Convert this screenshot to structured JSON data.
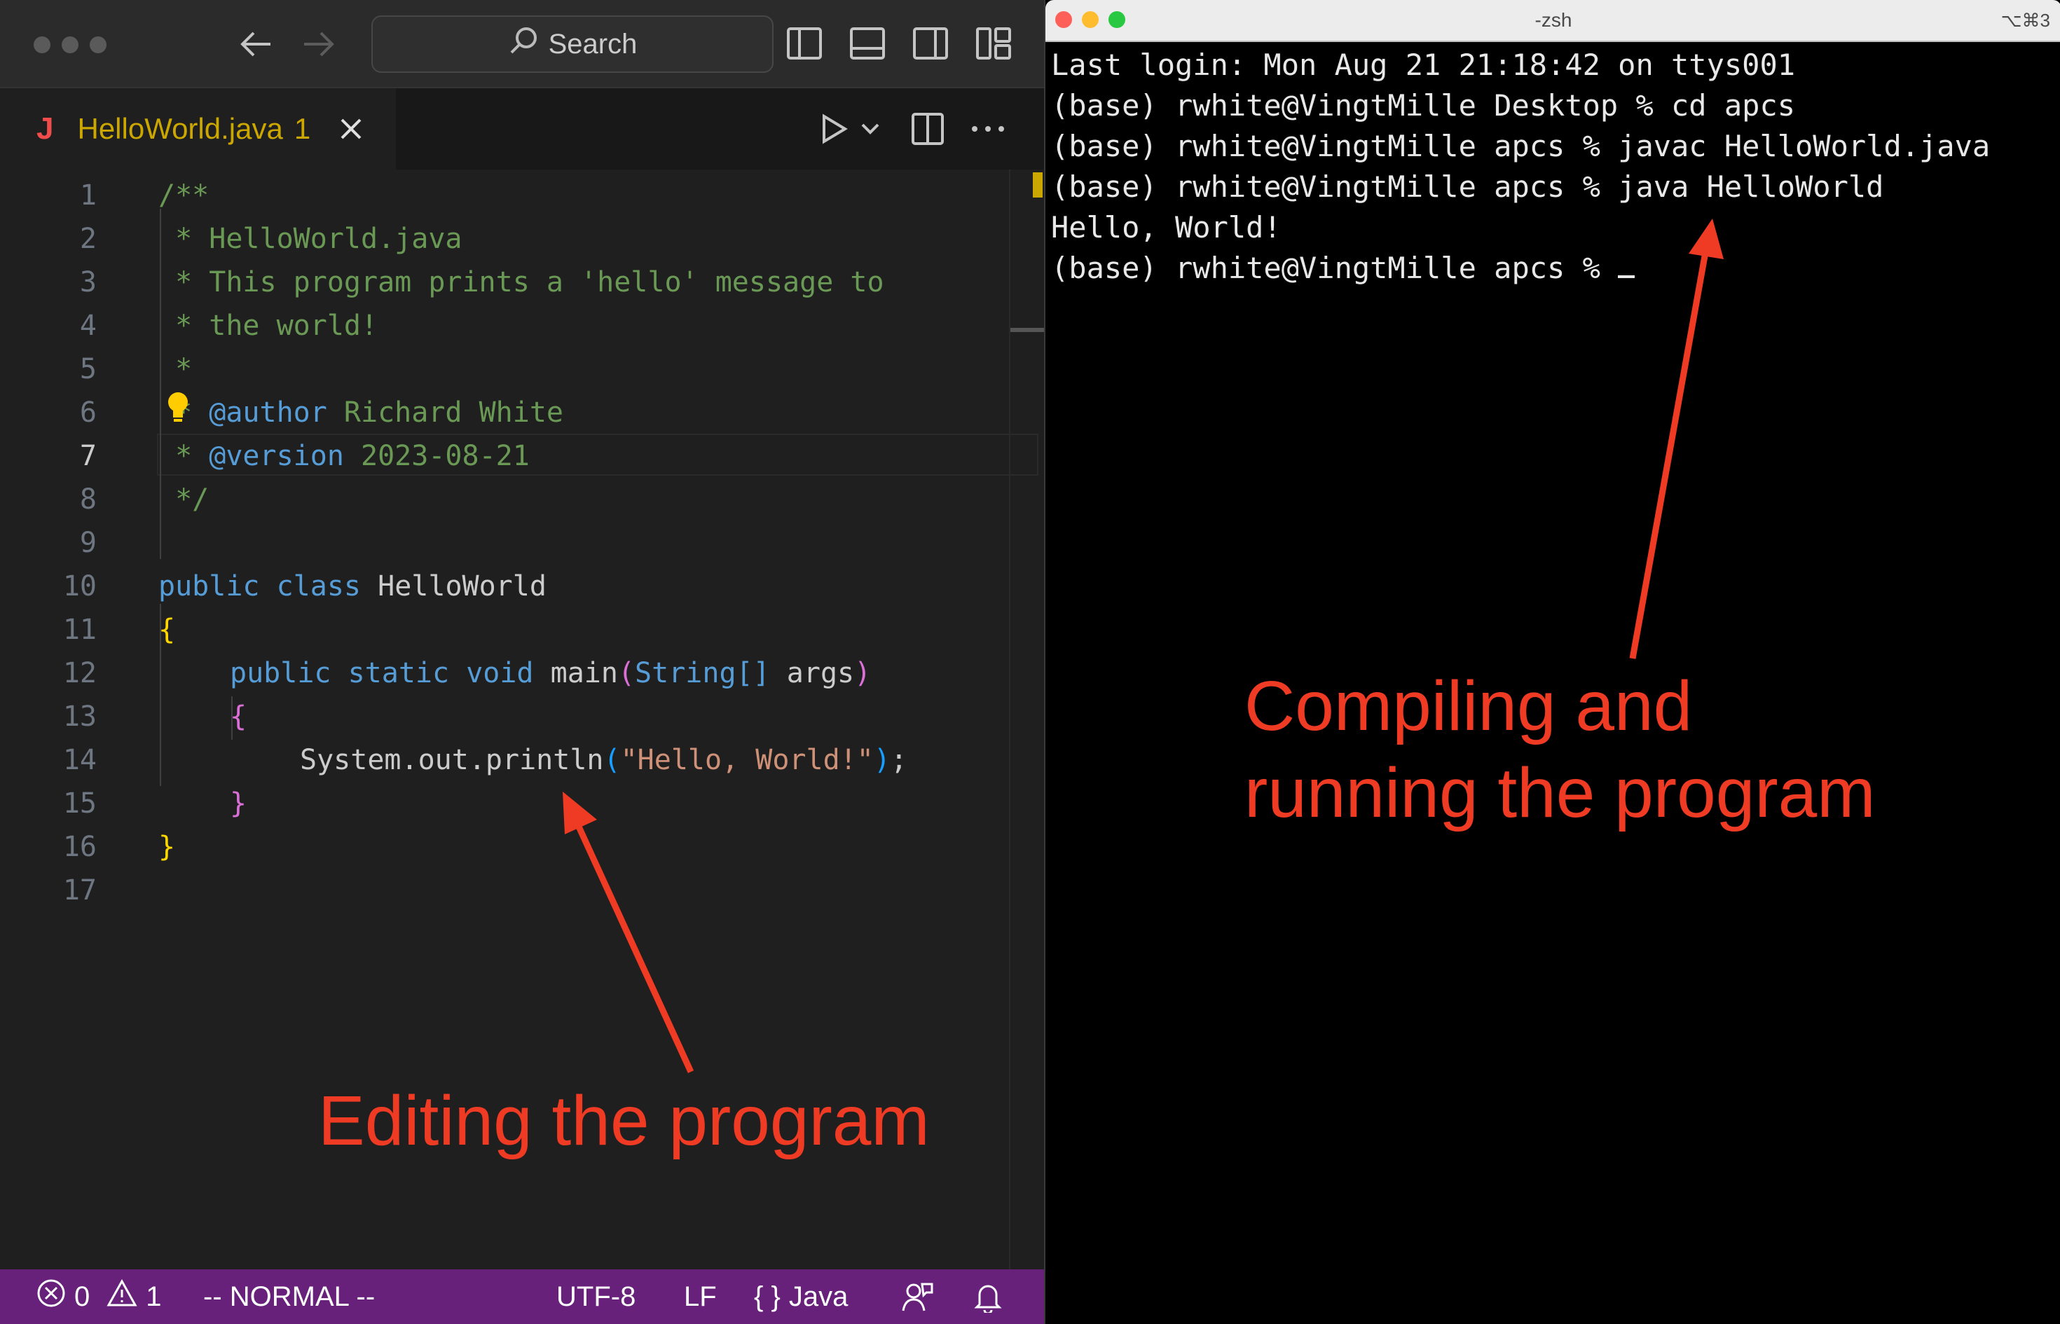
{
  "editor": {
    "search_placeholder": "Search",
    "tab": {
      "icon_letter": "J",
      "filename": "HelloWorld.java",
      "problem_count": "1"
    },
    "line_numbers": [
      "1",
      "2",
      "3",
      "4",
      "5",
      "6",
      "7",
      "8",
      "9",
      "10",
      "11",
      "12",
      "13",
      "14",
      "15",
      "16",
      "17"
    ],
    "active_line": 7,
    "code": {
      "l1": "/**",
      "l2": " * HelloWorld.java",
      "l3": " * This program prints a 'hello' message to",
      "l4": " * the world!",
      "l5": " *",
      "l6_star": " * ",
      "l6_tag": "@author",
      "l6_rest": " Richard White",
      "l7_star": " * ",
      "l7_tag": "@version",
      "l7_rest": " 2023-08-21",
      "l8": " */",
      "l10_kw1": "public",
      "l10_kw2": "class",
      "l10_name": "HelloWorld",
      "l11": "{",
      "l12_kw1": "public",
      "l12_kw2": "static",
      "l12_kw3": "void",
      "l12_fn": "main",
      "l12_lp": "(",
      "l12_type": "String",
      "l12_br": "[]",
      "l12_arg": "args",
      "l12_rp": ")",
      "l13": "{",
      "l14_obj": "System.out.",
      "l14_fn": "println",
      "l14_lp": "(",
      "l14_str": "\"Hello, World!\"",
      "l14_rp": ")",
      "l14_semi": ";",
      "l15": "}",
      "l16": "}"
    }
  },
  "statusbar": {
    "errors": "0",
    "warnings": "1",
    "mode": "-- NORMAL --",
    "encoding": "UTF-8",
    "eol": "LF",
    "language_icon": "{ }",
    "language": "Java"
  },
  "terminal": {
    "title": "-zsh",
    "shortcut": "⌥⌘3",
    "lines": [
      "Last login: Mon Aug 21 21:18:42 on ttys001",
      "(base) rwhite@VingtMille Desktop % cd apcs",
      "(base) rwhite@VingtMille apcs % javac HelloWorld.java",
      "(base) rwhite@VingtMille apcs % java HelloWorld",
      "Hello, World!",
      "(base) rwhite@VingtMille apcs % "
    ]
  },
  "annotations": {
    "editing": "Editing the program",
    "compiling": "Compiling and\nrunning the program"
  },
  "colors": {
    "annotation": "#ef3b24",
    "statusbar": "#68217a",
    "warning": "#cca700",
    "comment": "#6a9955",
    "keyword": "#569cd6"
  }
}
